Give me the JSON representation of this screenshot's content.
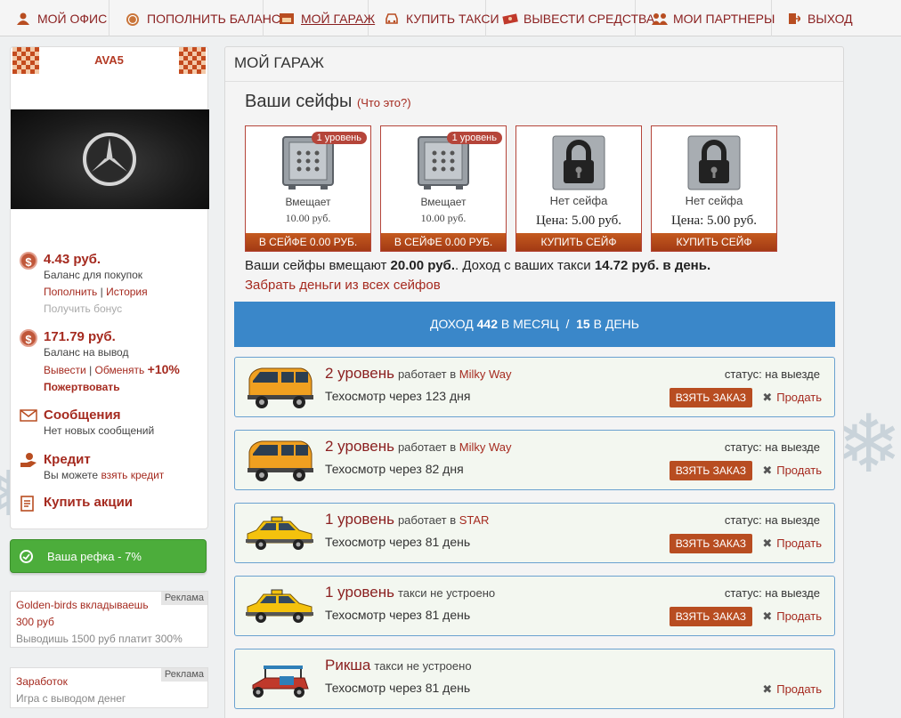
{
  "nav": [
    {
      "label": "МОЙ ОФИС",
      "icon": "users-icon"
    },
    {
      "label": "ПОПОЛНИТЬ БАЛАНС",
      "icon": "coin-icon"
    },
    {
      "label": "МОЙ ГАРАЖ",
      "icon": "garage-icon"
    },
    {
      "label": "КУПИТЬ ТАКСИ",
      "icon": "car-icon"
    },
    {
      "label": "ВЫВЕСТИ СРЕДСТВА",
      "icon": "money-icon"
    },
    {
      "label": "МОИ ПАРТНЕРЫ",
      "icon": "partners-icon"
    },
    {
      "label": "ВЫХОД",
      "icon": "exit-icon"
    }
  ],
  "profile": {
    "username": "AVA5",
    "balance_buy": {
      "amount": "4.43 руб.",
      "label": "Баланс для покупок",
      "topup": "Пополнить",
      "history": "История",
      "bonus": "Получить бонус"
    },
    "balance_out": {
      "amount": "171.79 руб.",
      "label": "Баланс на вывод",
      "withdraw": "Вывести",
      "exchange": "Обменять",
      "bonus": "+10%",
      "donate": "Пожертвовать"
    },
    "messages": {
      "title": "Сообщения",
      "text": "Нет новых сообщений"
    },
    "credit": {
      "title": "Кредит",
      "text": "Вы можете",
      "link": "взять кредит"
    },
    "shares": {
      "title": "Купить акции"
    }
  },
  "refka": "Ваша рефка - 7%",
  "ads": [
    {
      "tag": "Реклама",
      "title": "Golden-birds вкладываешь 300 руб",
      "text": "Выводишь 1500 руб платит 300%"
    },
    {
      "tag": "Реклама",
      "title": "Заработок",
      "text": "Игра с выводом денег"
    }
  ],
  "main": {
    "title": "МОЙ ГАРАЖ",
    "safes_title": "Ваши сейфы",
    "safes_help": "(Что это?)",
    "safes": [
      {
        "badge": "1 уровень",
        "line1": "Вмещает",
        "line2": "10.00 руб.",
        "button": "В СЕЙФЕ 0.00 РУБ.",
        "locked": false
      },
      {
        "badge": "1 уровень",
        "line1": "Вмещает",
        "line2": "10.00 руб.",
        "button": "В СЕЙФЕ 0.00 РУБ.",
        "locked": false
      },
      {
        "line1": "Нет сейфа",
        "price": "Цена: 5.00 руб.",
        "button": "КУПИТЬ СЕЙФ",
        "locked": true
      },
      {
        "line1": "Нет сейфа",
        "price": "Цена: 5.00 руб.",
        "button": "КУПИТЬ СЕЙФ",
        "locked": true
      }
    ],
    "summary": {
      "p1": "Ваши сейфы вмещают ",
      "cap": "20.00 руб.",
      "p2": ". Доход с ваших такси ",
      "daily": "14.72 руб. в день."
    },
    "take_all": "Забрать деньги из всех сейфов",
    "income": {
      "p1": "ДОХОД ",
      "month": "442",
      "p2": " В МЕСЯЦ  /  ",
      "day": "15",
      "p3": " В ДЕНЬ"
    },
    "cars": [
      {
        "type": "minibus",
        "level": "2 уровень",
        "works": "работает в",
        "place": "Milky Way",
        "tech": "Техосмотр через 123 дня",
        "status": "статус: на выезде",
        "take": "ВЗЯТЬ ЗАКАЗ",
        "sell": "Продать"
      },
      {
        "type": "minibus",
        "level": "2 уровень",
        "works": "работает в",
        "place": "Milky Way",
        "tech": "Техосмотр через 82 дня",
        "status": "статус: на выезде",
        "take": "ВЗЯТЬ ЗАКАЗ",
        "sell": "Продать"
      },
      {
        "type": "taxi",
        "level": "1 уровень",
        "works": "работает в",
        "place": "STAR",
        "tech": "Техосмотр через 81 день",
        "status": "статус: на выезде",
        "take": "ВЗЯТЬ ЗАКАЗ",
        "sell": "Продать"
      },
      {
        "type": "taxi",
        "level": "1 уровень",
        "works": "такси не устроено",
        "place": "",
        "tech": "Техосмотр через 81 день",
        "status": "статус: на выезде",
        "take": "ВЗЯТЬ ЗАКАЗ",
        "sell": "Продать"
      },
      {
        "type": "rickshaw",
        "level": "Рикша",
        "works": "такси не устроено",
        "place": "",
        "tech": "Техосмотр через 81 день",
        "status": "",
        "take": "",
        "sell": "Продать"
      }
    ]
  },
  "colors": {
    "accent": "#a52a1f",
    "income_bar": "#3a87c9",
    "refka": "#4cad3b",
    "button": "#b84d21"
  }
}
